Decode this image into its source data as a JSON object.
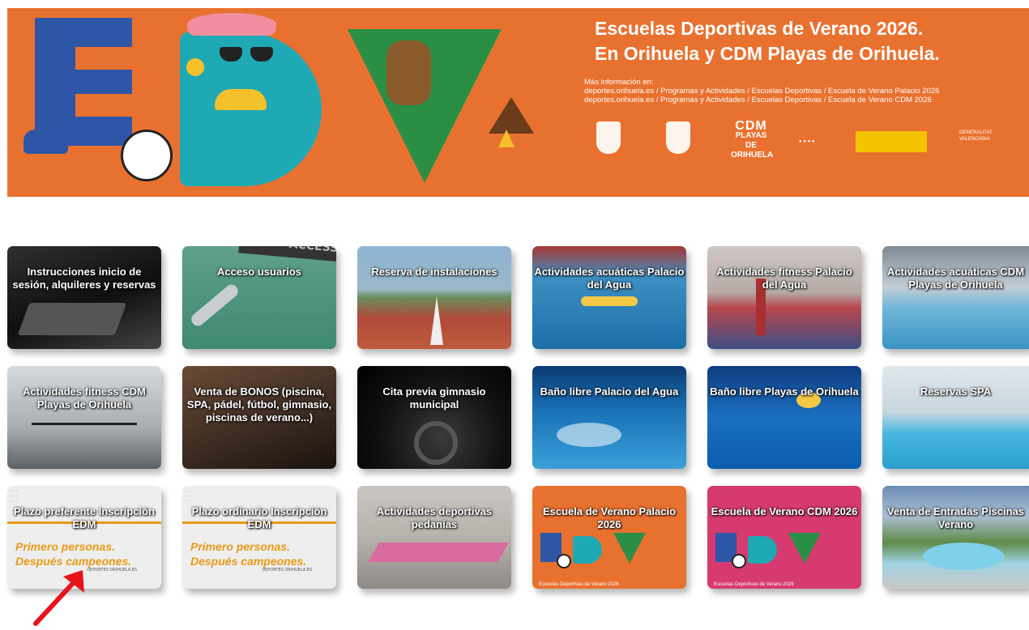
{
  "banner": {
    "title_line1": "Escuelas Deportivas de Verano 2026.",
    "title_line2": "En Orihuela y CDM Playas de Orihuela.",
    "info_heading": "Más información en:",
    "info_line1": "deportes.orihuela.es / Programas y Actividades / Escuelas Deportivas / Escuela de Verano Palacio 2026",
    "info_line2": "deportes.orihuela.es / Programas y Actividades / Escuelas Deportivas / Escuela de Verano CDM 2026",
    "logo_cdm_line1": "CDM",
    "logo_cdm_line2": "PLAYAS DE",
    "logo_cdm_line3": "ORIHUELA",
    "logo_generalitat": "GENERALITAT VALENCIANA"
  },
  "tiles": [
    {
      "label": "Instrucciones inicio de sesión, alquileres y reservas"
    },
    {
      "label": "Acceso usuarios"
    },
    {
      "label": "Reserva de instalaciones"
    },
    {
      "label": "Actividades acuáticas Palacio del Agua"
    },
    {
      "label": "Actividades fitness Palacio del Agua"
    },
    {
      "label": "Actividades acuáticas CDM Playas de Orihuela"
    },
    {
      "label": "Actividades fitness CDM Playas de Orihuela"
    },
    {
      "label": "Venta de BONOS (piscina, SPA, pádel, fútbol, gimnasio, piscinas de verano...)"
    },
    {
      "label": "Cita previa gimnasio municipal"
    },
    {
      "label": "Baño libre Palacio del Agua"
    },
    {
      "label": "Baño libre Playas de Orihuela"
    },
    {
      "label": "Reservas SPA"
    },
    {
      "label": "Plazo preferente Inscripción EDM",
      "slogan1": "Primero personas.",
      "slogan2": "Después campeones.",
      "footer": "DEPORTES ORIHUELA.ES"
    },
    {
      "label": "Plazo ordinario Inscripción EDM",
      "slogan1": "Primero personas.",
      "slogan2": "Después campeones.",
      "footer": "DEPORTES ORIHUELA.ES"
    },
    {
      "label": "Actividades deportivas pedanías"
    },
    {
      "label": "Escuela de Verano Palacio 2026",
      "footer": "Escuelas Deportivas de Verano 2026"
    },
    {
      "label": "Escuela de Verano CDM 2026",
      "footer": "Escuelas Deportivas de Verano 2026"
    },
    {
      "label": "Venta de Entradas Piscinas Verano"
    }
  ],
  "colors": {
    "banner_orange": "#e9712f",
    "edv_blue": "#2d56a6",
    "edv_teal": "#1fa9b5",
    "edv_green": "#2a8f45",
    "slogan_orange": "#e79a16",
    "pink_tile": "#d73a6e",
    "arrow_red": "#e8141c"
  },
  "annotation": {
    "arrow": "red-arrow-icon"
  }
}
